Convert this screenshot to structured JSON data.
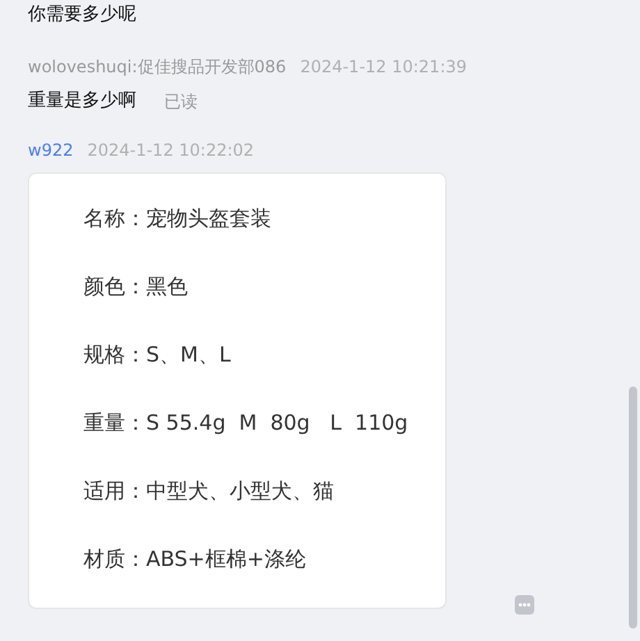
{
  "messages": [
    {
      "kind": "text",
      "text": "你需要多少呢"
    },
    {
      "kind": "meta",
      "sender": "woloveshuqi:促佳搜品开发部086",
      "time": "2024-1-12 10:21:39",
      "self": false
    },
    {
      "kind": "text",
      "text": "重量是多少啊",
      "status": "已读"
    },
    {
      "kind": "meta",
      "sender": "w922",
      "time": "2024-1-12 10:22:02",
      "self": true
    },
    {
      "kind": "card",
      "lines": [
        {
          "label": "名称：",
          "value": "宠物头盔套装"
        },
        {
          "label": "颜色：",
          "value": "黑色"
        },
        {
          "label": "规格：",
          "value": "S、M、L"
        },
        {
          "label": "重量：",
          "value": "S 55.4g  M  80g   L  110g"
        },
        {
          "label": "适用：",
          "value": "中型犬、小型犬、猫"
        },
        {
          "label": "材质：",
          "value": "ABS+框棉+涤纶"
        }
      ]
    }
  ]
}
